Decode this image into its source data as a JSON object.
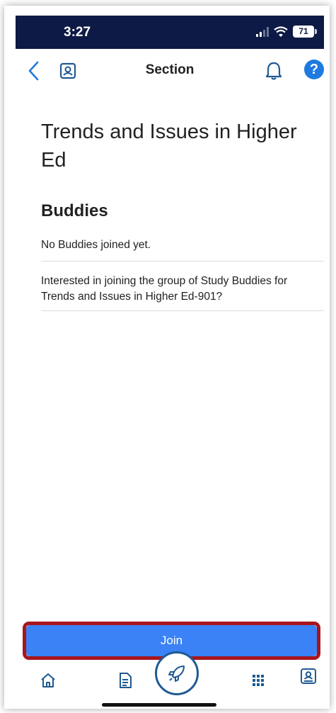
{
  "status_bar": {
    "time": "3:27",
    "battery": "71"
  },
  "nav": {
    "title": "Section"
  },
  "content": {
    "page_title": "Trends and Issues in Higher Ed",
    "buddies_heading": "Buddies",
    "empty_text": "No Buddies joined yet.",
    "invite_text": "Interested in joining the group of Study Buddies for Trends and Issues in Higher Ed-901?"
  },
  "join": {
    "label": "Join"
  },
  "icons": {
    "back": "back-chevron-icon",
    "profile": "profile-card-icon",
    "bell": "bell-icon",
    "help": "help-icon",
    "home": "home-icon",
    "document": "document-icon",
    "launch": "rocket-icon",
    "apps": "apps-grid-icon",
    "profile_tab": "profile-card-icon"
  },
  "colors": {
    "status_bar": "#0d1a45",
    "accent": "#1f7ae0",
    "join_button": "#3b82f6",
    "highlight": "#a8151d",
    "tab_icon": "#1f5a93"
  }
}
